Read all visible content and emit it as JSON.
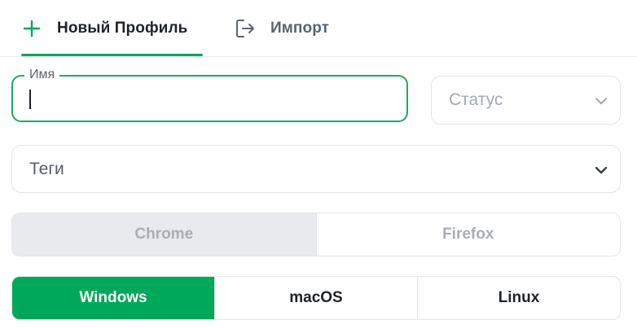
{
  "tabs": {
    "new_profile": {
      "label": "Новый Профиль",
      "icon": "plus-icon"
    },
    "import": {
      "label": "Импорт",
      "icon": "import-icon"
    }
  },
  "form": {
    "name": {
      "label": "Имя",
      "value": ""
    },
    "status": {
      "placeholder": "Статус"
    },
    "tags": {
      "placeholder": "Теги"
    }
  },
  "browser": {
    "options": [
      "Chrome",
      "Firefox"
    ],
    "selected": "Chrome"
  },
  "os": {
    "options": [
      "Windows",
      "macOS",
      "Linux"
    ],
    "selected": "Windows"
  },
  "colors": {
    "accent": "#00a85a",
    "border": "#e3e5e8",
    "disabled_text": "#a9aeb6"
  }
}
